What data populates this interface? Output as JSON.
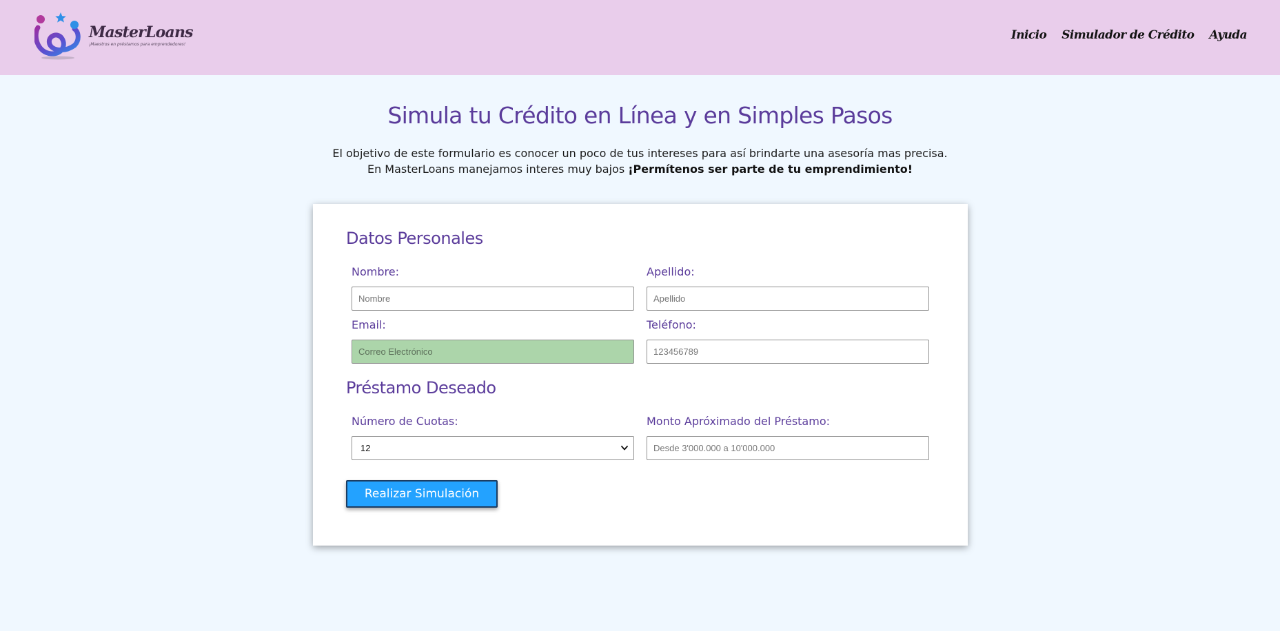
{
  "header": {
    "logo": {
      "name": "MasterLoans",
      "tagline": "¡Maestros en préstamos para emprendedores!"
    },
    "nav": [
      "Inicio",
      "Simulador de Crédito",
      "Ayuda"
    ]
  },
  "main": {
    "title": "Simula tu Crédito en Línea y en Simples Pasos",
    "intro_line1": "El objetivo de este formulario es conocer un poco de tus intereses para así brindarte una asesoría mas precisa.",
    "intro_line2": "En MasterLoans manejamos interes muy bajos ",
    "intro_emphasis": "¡Permítenos ser parte de tu emprendimiento!"
  },
  "form": {
    "personal": {
      "title": "Datos Personales",
      "nombre": {
        "label": "Nombre:",
        "placeholder": "Nombre",
        "value": ""
      },
      "apellido": {
        "label": "Apellido:",
        "placeholder": "Apellido",
        "value": ""
      },
      "email": {
        "label": "Email:",
        "placeholder": "Correo Electrónico",
        "value": ""
      },
      "telefono": {
        "label": "Teléfono:",
        "placeholder": "123456789",
        "value": ""
      }
    },
    "loan": {
      "title": "Préstamo Deseado",
      "cuotas": {
        "label": "Número de Cuotas:",
        "selected": "12"
      },
      "monto": {
        "label": "Monto Apróximado del Préstamo:",
        "placeholder": "Desde 3'000.000 a 10'000.000",
        "value": ""
      }
    },
    "submit_label": "Realizar Simulación"
  },
  "colors": {
    "header_bg": "#e9cdeb",
    "page_bg": "#f0f8ff",
    "accent_purple": "#5b3c9b",
    "button_blue": "#23a2ff",
    "email_field_bg": "#acd5aa"
  },
  "icons": {
    "logo": "masterloans-logo-icon",
    "select": "chevron-down-icon"
  }
}
